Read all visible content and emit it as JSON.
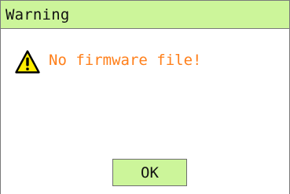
{
  "dialog": {
    "title": "Warning",
    "message": "No firmware file!",
    "icon": "warning-triangle-icon",
    "ok_label": "OK"
  },
  "colors": {
    "title_bar": "#ccf59a",
    "button": "#ccf59a",
    "message_text": "#ff7f1a",
    "icon_fill": "#ffee00"
  }
}
